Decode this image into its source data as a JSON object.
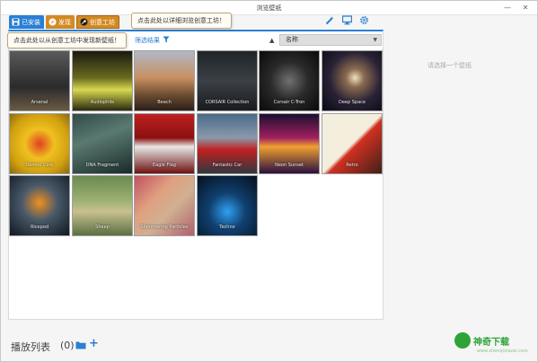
{
  "window": {
    "title": "浏览壁纸",
    "minimize": "—",
    "close": "✕"
  },
  "tabs": [
    {
      "label": "已安装",
      "icon": "save-icon"
    },
    {
      "label": "发现",
      "icon": "compass-icon"
    },
    {
      "label": "创意工坊",
      "icon": "steam-icon"
    }
  ],
  "toolbar": {
    "icons": [
      "wand-icon",
      "monitor-icon",
      "gear-icon"
    ]
  },
  "tooltips": {
    "details": "点击此处以详细浏览创意工坊！",
    "discover": "点击此处以从创意工坊中发现新壁纸！"
  },
  "filter": {
    "label": "筛选结果",
    "icon": "filter-icon"
  },
  "sort": {
    "arrow": "▲",
    "selected": "名称",
    "caret": "▼"
  },
  "wallpapers": [
    {
      "label": "Arsenal",
      "bg": "linear-gradient(180deg,#5a5a5a 0%,#2b2b2b 60%,#6a5a44 100%)"
    },
    {
      "label": "Audiophile",
      "bg": "linear-gradient(180deg,#1a1a10 0%,#6a6a20 45%,#d8d850 65%,#2a2a10 100%)"
    },
    {
      "label": "Beach",
      "bg": "linear-gradient(180deg,#b0b8c8 0%,#c88f60 45%,#6a4a30 75%,#2b2018 100%)"
    },
    {
      "label": "CORSAIR Collection",
      "bg": "linear-gradient(180deg,#202428 0%,#3a4046 50%,#1a1c1e 100%)"
    },
    {
      "label": "Corsair C-Tron",
      "bg": "radial-gradient(circle at 50% 50%,#707070 0%,#2a2a2a 45%,#0a0a0a 100%)"
    },
    {
      "label": "Deep Space",
      "bg": "radial-gradient(circle at 55% 45%,#f0e0c0 0%,#8a6a50 20%,#2a2236 55%,#0a0a14 100%)"
    },
    {
      "label": "Demon Core",
      "bg": "radial-gradient(circle at 50% 50%,#e04020 0%,#f0c020 35%,#d0a010 70%,#8a6a10 100%)"
    },
    {
      "label": "DNA Fragment",
      "bg": "linear-gradient(160deg,#304a4a 0%,#5a7a70 40%,#1a2a2a 100%)"
    },
    {
      "label": "Eagle Flag",
      "bg": "linear-gradient(180deg,#c02020 0%,#8a1010 40%,#e8e8e8 55%,#701010 100%)"
    },
    {
      "label": "Fantastic Car",
      "bg": "linear-gradient(180deg,#4a6a8a 0%,#8a9aaa 40%,#c02020 60%,#303840 100%)"
    },
    {
      "label": "Neon Sunset",
      "bg": "linear-gradient(180deg,#1a1030 0%,#a02060 40%,#f0a030 55%,#2a1040 100%)"
    },
    {
      "label": "Retro",
      "bg": "linear-gradient(135deg,#f4eedd 0%,#f4eedd 50%,#d03020 55%,#402018 100%)"
    },
    {
      "label": "Ricepod",
      "bg": "radial-gradient(circle at 50% 45%,#f09020 0%,#4a5a6a 40%,#101820 100%)"
    },
    {
      "label": "Sheep",
      "bg": "linear-gradient(180deg,#6a8a50 0%,#9ab070 40%,#c8c090 60%,#5a7040 100%)"
    },
    {
      "label": "Shimmering Particles",
      "bg": "linear-gradient(135deg,#c05060 0%,#e0a080 35%,#d0b090 60%,#b06070 100%)"
    },
    {
      "label": "Techno",
      "bg": "radial-gradient(circle at 50% 60%,#30a0f0 0%,#104070 40%,#05101c 100%)"
    }
  ],
  "preview": {
    "placeholder": "请选择一个壁纸"
  },
  "playlist": {
    "label": "播放列表",
    "count": "(0)",
    "add": "+"
  },
  "watermark": {
    "text": "神奇下载",
    "url": "www.shenqixiazai.com"
  },
  "colors": {
    "accent": "#2a7fd4",
    "tab_orange": "#d38a21",
    "watermark": "#2fa33a"
  }
}
